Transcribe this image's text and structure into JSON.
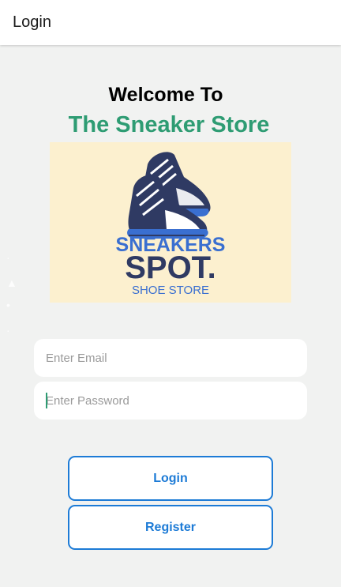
{
  "app_bar": {
    "title": "Login"
  },
  "welcome": {
    "heading": "Welcome To",
    "store_name": "The Sneaker Store"
  },
  "logo": {
    "line1": "SNEAKERS",
    "line2": "SPOT.",
    "line3": "SHOE STORE",
    "colors": {
      "background": "#fcf0cf",
      "navy": "#2f3a63",
      "blue": "#3a6fd0"
    }
  },
  "form": {
    "email_placeholder": "Enter Email",
    "password_placeholder": "Enter Password"
  },
  "buttons": {
    "login": "Login",
    "register": "Register"
  },
  "colors": {
    "accent_green": "#2e9c73",
    "button_blue": "#1d7bd6",
    "page_bg": "#f1f2f1"
  }
}
